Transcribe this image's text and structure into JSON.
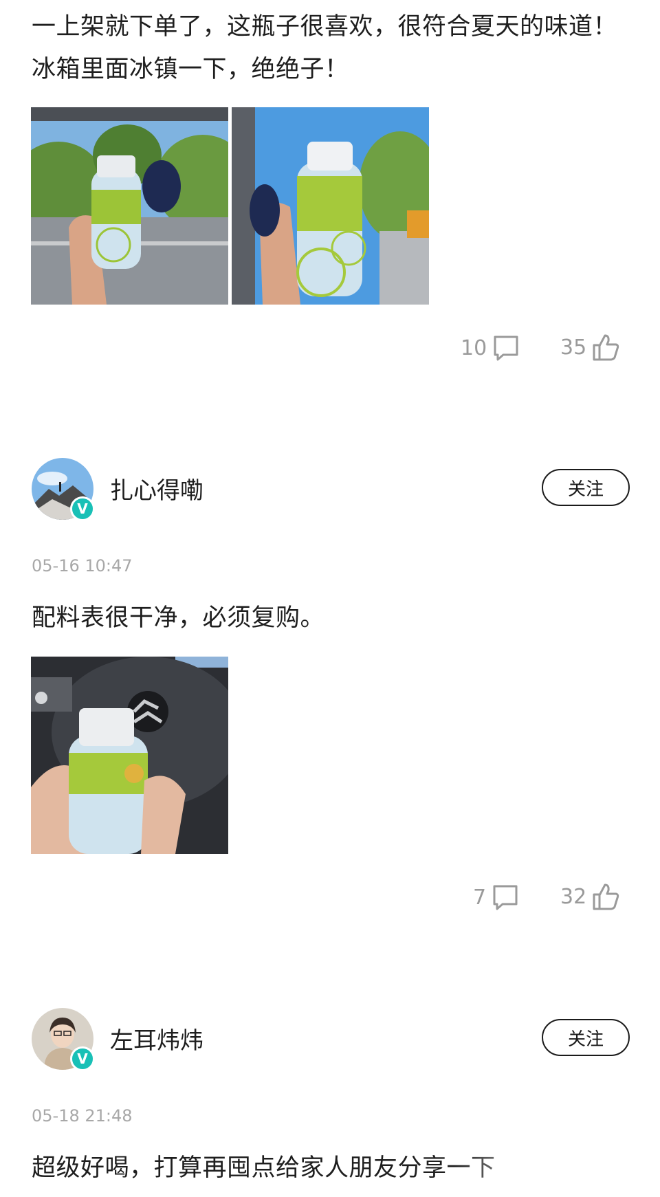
{
  "posts": [
    {
      "text_lines": [
        "一上架就下单了，这瓶子很喜欢，很符合夏天的味道！",
        "冰箱里面冰镇一下，绝绝子！"
      ],
      "comments": "10",
      "likes": "35"
    },
    {
      "author": "扎心得嘞",
      "follow_label": "关注",
      "verified_mark": "V",
      "timestamp": "05-16 10:47",
      "text": "配料表很干净，必须复购。",
      "comments": "7",
      "likes": "32"
    },
    {
      "author": "左耳炜炜",
      "follow_label": "关注",
      "verified_mark": "V",
      "timestamp": "05-18 21:48",
      "text": "超级好喝，打算再囤点给家人朋友分享一下"
    }
  ],
  "icons": {
    "comment": "comment-icon",
    "like": "thumbs-up-icon"
  },
  "colors": {
    "verified_badge": "#19c0b6",
    "meta_text": "#9a9a9a"
  }
}
